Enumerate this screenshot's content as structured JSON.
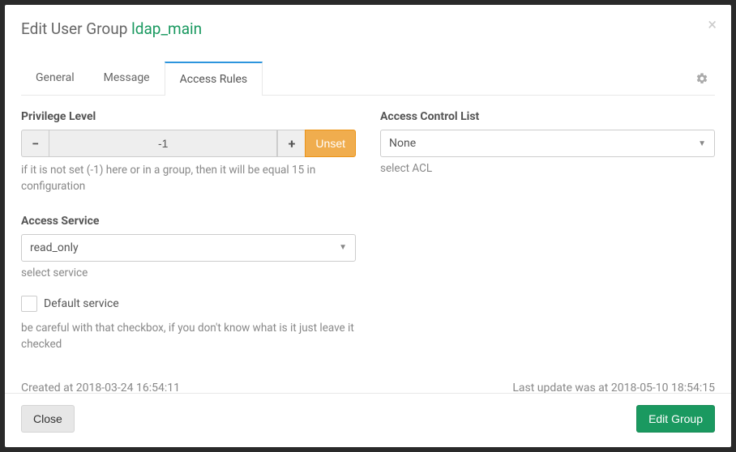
{
  "header": {
    "title_prefix": "Edit User Group",
    "group_name": "ldap_main",
    "close_symbol": "×"
  },
  "tabs": [
    {
      "label": "General",
      "active": false
    },
    {
      "label": "Message",
      "active": false
    },
    {
      "label": "Access Rules",
      "active": true
    }
  ],
  "privilege": {
    "label": "Privilege Level",
    "value": "-1",
    "minus": "−",
    "plus": "+",
    "unset_label": "Unset",
    "help": "if it is not set (-1) here or in a group, then it will be equal 15 in configuration"
  },
  "access_service": {
    "label": "Access Service",
    "value": "read_only",
    "help": "select service"
  },
  "default_service": {
    "label": "Default service",
    "checked": false,
    "help": "be careful with that checkbox, if you don't know what is it just leave it checked"
  },
  "acl": {
    "label": "Access Control List",
    "value": "None",
    "help": "select ACL"
  },
  "timestamps": {
    "created": "Created at 2018-03-24 16:54:11",
    "updated": "Last update was at 2018-05-10 18:54:15"
  },
  "footer": {
    "close_label": "Close",
    "submit_label": "Edit Group"
  }
}
